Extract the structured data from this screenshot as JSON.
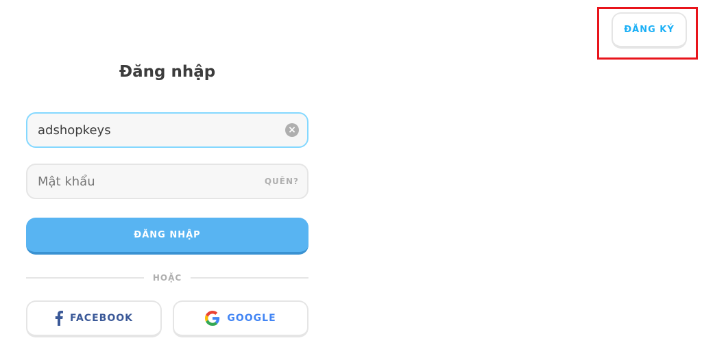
{
  "header": {
    "signup_label": "ĐĂNG KÝ"
  },
  "login": {
    "title": "Đăng nhập",
    "username_value": "adshopkeys",
    "password_placeholder": "Mật khẩu",
    "forgot_label": "QUÊN?",
    "submit_label": "ĐĂNG NHẬP",
    "divider_label": "HOẶC"
  },
  "social": {
    "facebook_label": "FACEBOOK",
    "google_label": "GOOGLE"
  },
  "colors": {
    "accent": "#58b4f2",
    "highlight": "#e8141b",
    "facebook": "#3b5998",
    "google": "#4285f4"
  },
  "icons": [
    "clear-icon",
    "facebook-icon",
    "google-icon"
  ]
}
